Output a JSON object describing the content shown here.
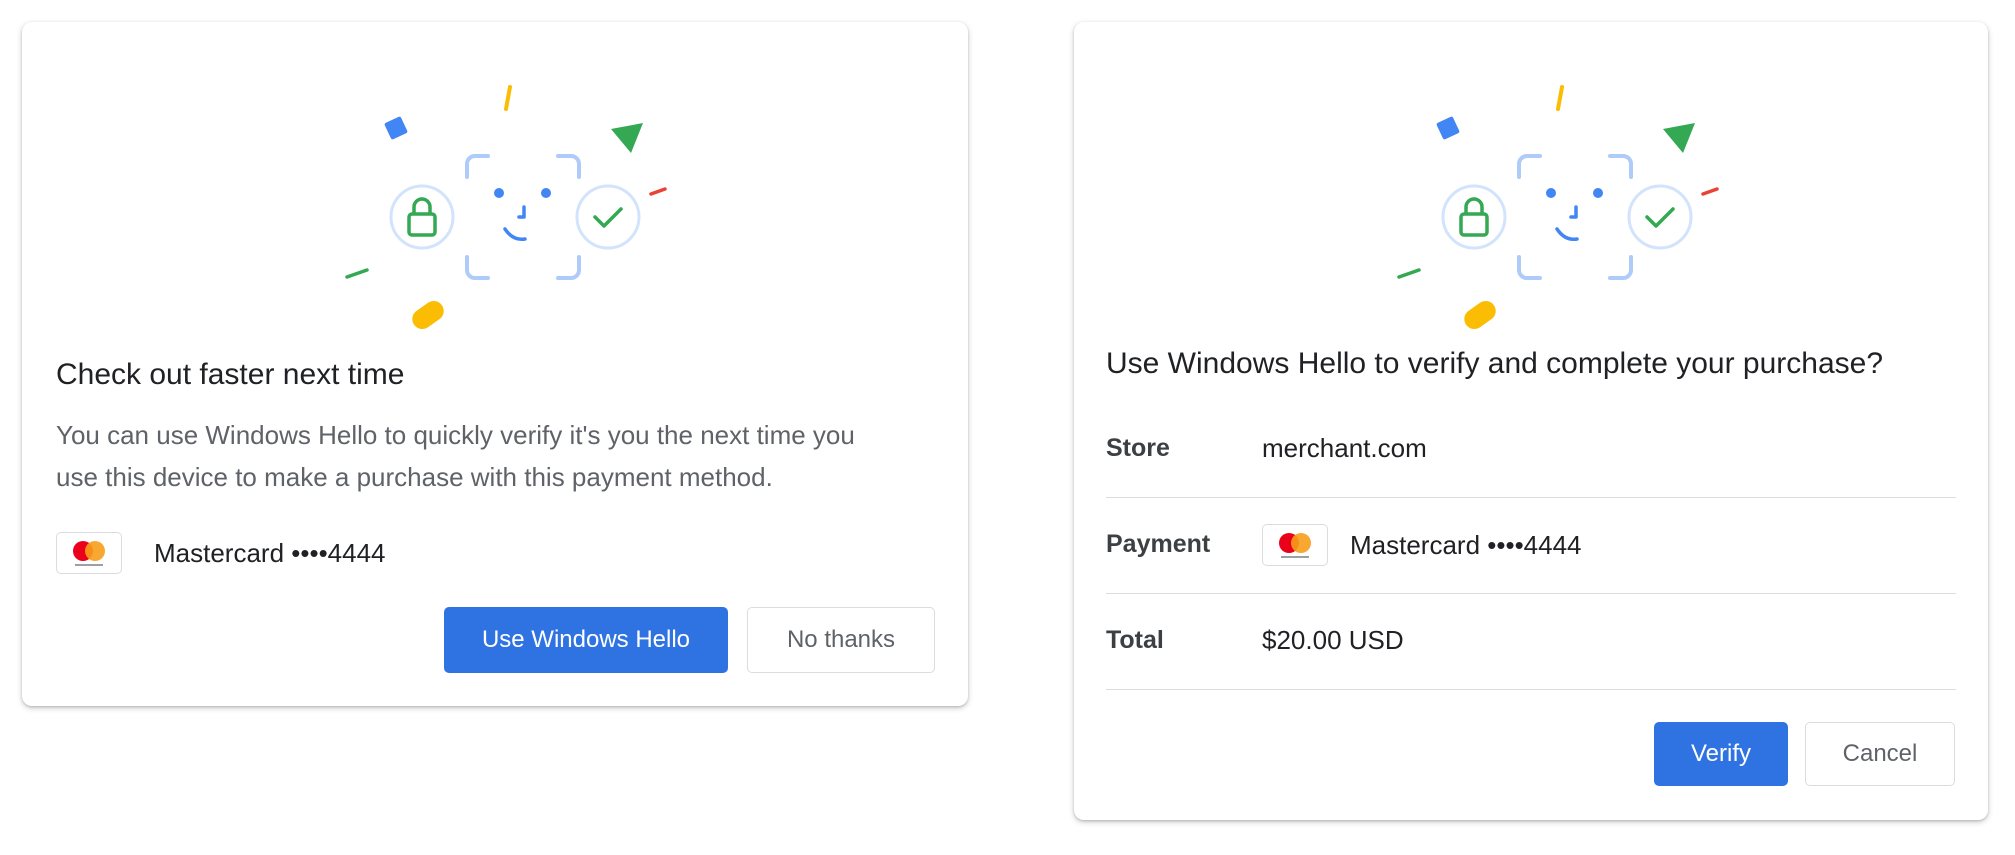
{
  "colors": {
    "primary": "#2f73e3",
    "green": "#34a853",
    "blue": "#4285f4",
    "yellow": "#fbbc04",
    "red": "#ea4335",
    "face_blue": "#aecbfa",
    "mastercard_red": "#eb001b",
    "mastercard_orange": "#f79e1b"
  },
  "enroll_dialog": {
    "title": "Check out faster next time",
    "body_line1": "You can use Windows Hello to quickly verify it's you the next time you",
    "body_line2": "use this device to make a purchase with this payment method.",
    "card_icon": "mastercard-logo",
    "card_label": "Mastercard ••••4444",
    "primary_button": "Use Windows Hello",
    "secondary_button": "No thanks"
  },
  "verify_dialog": {
    "title": "Use Windows Hello to verify and complete your purchase?",
    "rows": [
      {
        "label": "Store",
        "value": "merchant.com"
      },
      {
        "label": "Payment",
        "value": "Mastercard ••••4444"
      },
      {
        "label": "Total",
        "value": "$20.00 USD"
      }
    ],
    "card_icon": "mastercard-logo",
    "primary_button": "Verify",
    "secondary_button": "Cancel"
  }
}
